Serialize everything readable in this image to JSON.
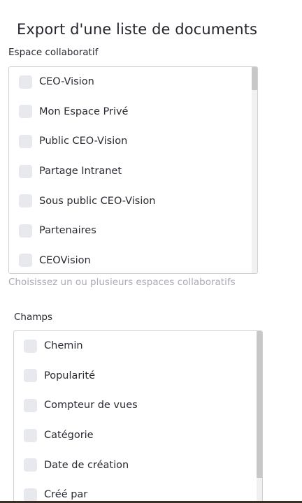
{
  "page": {
    "title": "Export d'une liste de documents"
  },
  "workspaces": {
    "label": "Espace collaboratif",
    "hint": "Choisissez un ou plusieurs espaces collaboratifs",
    "items": [
      {
        "label": "CEO-Vision",
        "checked": false
      },
      {
        "label": "Mon Espace Privé",
        "checked": false
      },
      {
        "label": "Public CEO-Vision",
        "checked": false
      },
      {
        "label": "Partage Intranet",
        "checked": false
      },
      {
        "label": "Sous public CEO-Vision",
        "checked": false
      },
      {
        "label": "Partenaires",
        "checked": false
      },
      {
        "label": "CEOVision",
        "checked": false
      }
    ]
  },
  "fields": {
    "label": "Champs",
    "items": [
      {
        "label": "Chemin",
        "checked": false
      },
      {
        "label": "Popularité",
        "checked": false
      },
      {
        "label": "Compteur de vues",
        "checked": false
      },
      {
        "label": "Catégorie",
        "checked": false
      },
      {
        "label": "Date de création",
        "checked": false
      },
      {
        "label": "Créé par",
        "checked": false
      }
    ]
  },
  "colors": {
    "checkbox_bg": "#e8e9ef",
    "hint_text": "#a9abb5",
    "border": "#cfd0d6"
  }
}
